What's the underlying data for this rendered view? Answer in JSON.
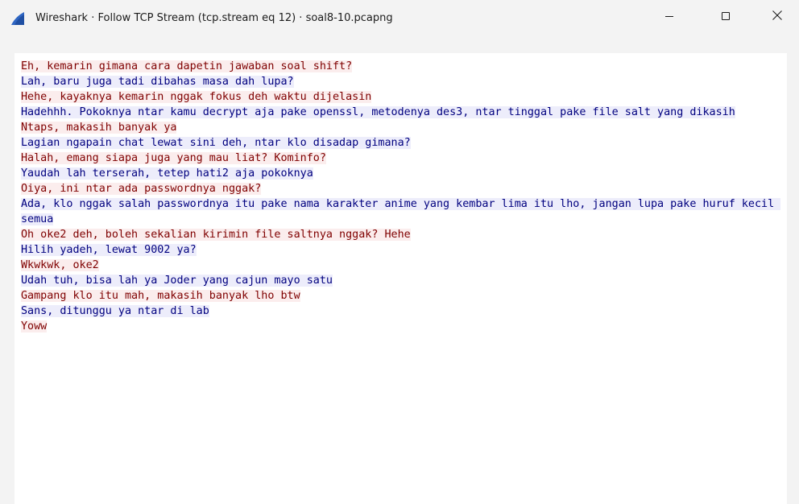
{
  "window": {
    "title": "Wireshark · Follow TCP Stream (tcp.stream eq 12) · soal8-10.pcapng",
    "icon": "wireshark-fin-icon",
    "minimize_icon": "minimize-icon",
    "maximize_icon": "maximize-icon",
    "close_icon": "close-icon"
  },
  "colors": {
    "client_bg": "#fbeded",
    "client_fg": "#7f0000",
    "server_bg": "#ededfb",
    "server_fg": "#00007f",
    "icon_blue": "#2f66c3"
  },
  "stream": {
    "messages": [
      {
        "side": "client",
        "text": "Eh, kemarin gimana cara dapetin jawaban soal shift?"
      },
      {
        "side": "server",
        "text": "Lah, baru juga tadi dibahas masa dah lupa?"
      },
      {
        "side": "client",
        "text": "Hehe, kayaknya kemarin nggak fokus deh waktu dijelasin"
      },
      {
        "side": "server",
        "text": "Hadehhh. Pokoknya ntar kamu decrypt aja pake openssl, metodenya des3, ntar tinggal pake file salt yang dikasih"
      },
      {
        "side": "client",
        "text": "Ntaps, makasih banyak ya"
      },
      {
        "side": "server",
        "text": "Lagian ngapain chat lewat sini deh, ntar klo disadap gimana?"
      },
      {
        "side": "client",
        "text": "Halah, emang siapa juga yang mau liat? Kominfo?"
      },
      {
        "side": "server",
        "text": "Yaudah lah terserah, tetep hati2 aja pokoknya"
      },
      {
        "side": "client",
        "text": "Oiya, ini ntar ada passwordnya nggak?"
      },
      {
        "side": "server",
        "text": "Ada, klo nggak salah passwordnya itu pake nama karakter anime yang kembar lima itu lho, jangan lupa pake huruf kecil semua"
      },
      {
        "side": "client",
        "text": "Oh oke2 deh, boleh sekalian kirimin file saltnya nggak? Hehe"
      },
      {
        "side": "server",
        "text": "Hilih yadeh, lewat 9002 ya?"
      },
      {
        "side": "client",
        "text": "Wkwkwk, oke2"
      },
      {
        "side": "server",
        "text": "Udah tuh, bisa lah ya Joder yang cajun mayo satu"
      },
      {
        "side": "client",
        "text": "Gampang klo itu mah, makasih banyak lho btw"
      },
      {
        "side": "server",
        "text": "Sans, ditunggu ya ntar di lab"
      },
      {
        "side": "client",
        "text": "Yoww"
      }
    ]
  }
}
